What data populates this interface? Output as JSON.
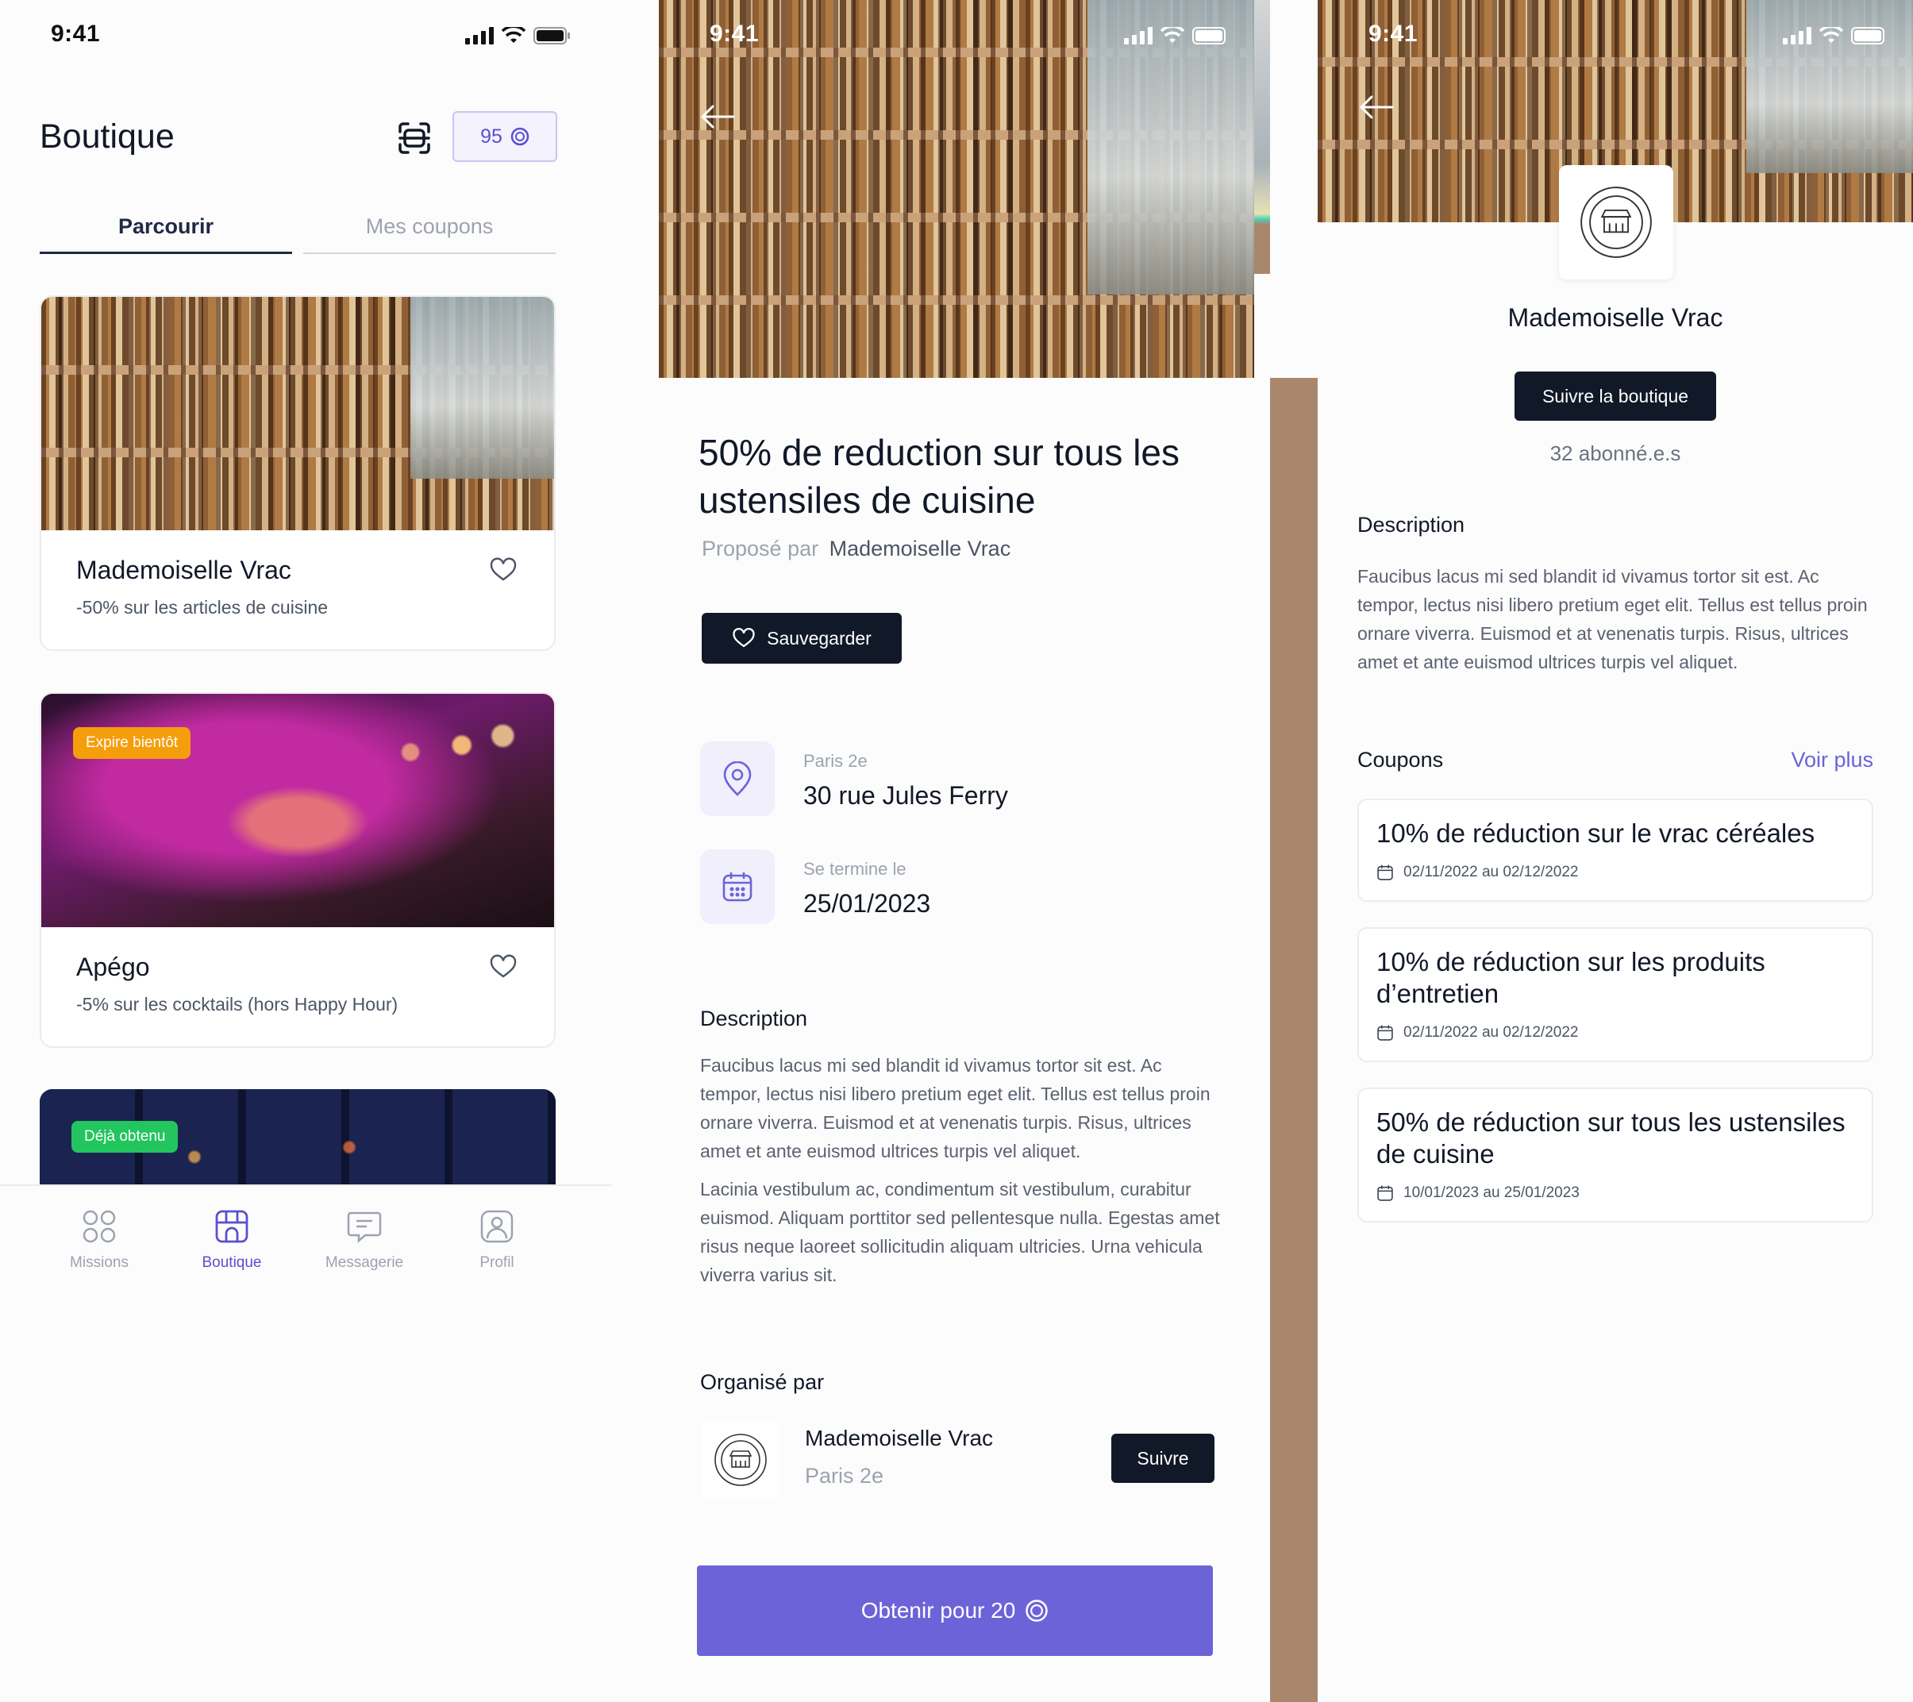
{
  "colors": {
    "accent": "#6c63d9",
    "accent_text": "#5b4fcf",
    "dark": "#111827",
    "badge_orange": "#f59e0b",
    "badge_green": "#22c55e",
    "gutter": "#a9876d"
  },
  "screen1": {
    "status_time": "9:41",
    "title": "Boutique",
    "scan_icon": "scan-icon",
    "points": "95",
    "tabs": [
      {
        "label": "Parcourir",
        "active": true
      },
      {
        "label": "Mes coupons",
        "active": false
      }
    ],
    "cards": [
      {
        "title": "Mademoiselle Vrac",
        "subtitle": "-50% sur les articles de cuisine",
        "badge": ""
      },
      {
        "title": "Apégo",
        "subtitle": "-5% sur les cocktails (hors Happy Hour)",
        "badge": "Expire bientôt"
      },
      {
        "title": "",
        "subtitle": "",
        "badge": "Déjà obtenu"
      }
    ],
    "nav": [
      {
        "label": "Missions",
        "icon": "grid-icon"
      },
      {
        "label": "Boutique",
        "icon": "store-icon"
      },
      {
        "label": "Messagerie",
        "icon": "chat-icon"
      },
      {
        "label": "Profil",
        "icon": "profile-icon"
      }
    ]
  },
  "screen2": {
    "status_time": "9:41",
    "title_line1": "50% de reduction sur tous les",
    "title_line2": "ustensiles de cuisine",
    "proposed_prefix": "Proposé par",
    "proposed_by": "Mademoiselle Vrac",
    "save_label": "Sauvegarder",
    "location_caption": "Paris 2e",
    "location_value": "30 rue Jules Ferry",
    "end_caption": "Se termine le",
    "end_value": "25/01/2023",
    "description_heading": "Description",
    "description_p1": "Faucibus lacus mi sed blandit id vivamus tortor sit est. Ac tempor, lectus nisi libero pretium eget elit. Tellus est tellus proin ornare viverra. Euismod et at venenatis turpis. Risus, ultrices amet et ante euismod ultrices turpis vel aliquet.",
    "description_p2": "Lacinia vestibulum ac, condimentum sit vestibulum, curabitur euismod. Aliquam porttitor sed pellentesque nulla. Egestas amet risus neque laoreet sollicitudin aliquam ultricies. Urna vehicula viverra varius sit.",
    "organizer_heading": "Organisé par",
    "organizer_name": "Mademoiselle Vrac",
    "organizer_city": "Paris 2e",
    "follow_label": "Suivre",
    "cta_label": "Obtenir pour 20"
  },
  "screen3": {
    "status_time": "9:41",
    "shop_name": "Mademoiselle Vrac",
    "follow_label": "Suivre la boutique",
    "followers": "32 abonné.e.s",
    "description_heading": "Description",
    "description": "Faucibus lacus mi sed blandit id vivamus tortor sit est. Ac tempor, lectus nisi libero pretium eget elit. Tellus est tellus proin ornare viverra. Euismod et at venenatis turpis. Risus, ultrices amet et ante euismod ultrices turpis vel aliquet.",
    "coupons_heading": "Coupons",
    "see_more": "Voir plus",
    "coupons": [
      {
        "title": "10% de réduction sur le vrac céréales",
        "dates": "02/11/2022 au 02/12/2022"
      },
      {
        "title": "10% de réduction sur les produits d’entretien",
        "dates": "02/11/2022 au 02/12/2022"
      },
      {
        "title": "50% de réduction sur tous les ustensiles de cuisine",
        "dates": "10/01/2023 au 25/01/2023"
      }
    ]
  }
}
